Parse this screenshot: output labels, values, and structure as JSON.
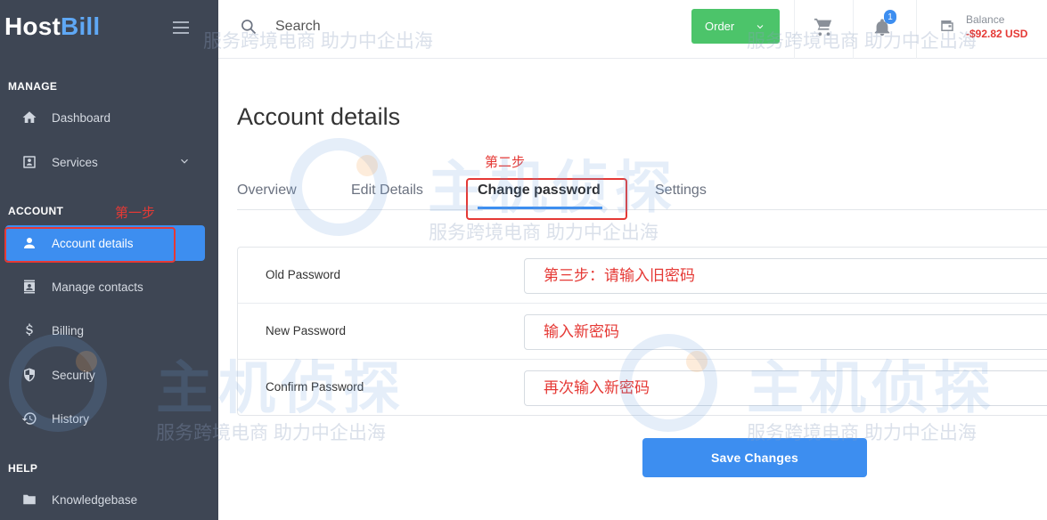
{
  "sidebar": {
    "brand_part1": "Host",
    "brand_part2": "Bill",
    "sections": {
      "manage": "MANAGE",
      "account": "ACCOUNT",
      "help": "HELP"
    },
    "items": [
      {
        "label": "Dashboard",
        "icon": "home-icon"
      },
      {
        "label": "Services",
        "icon": "services-icon"
      },
      {
        "label": "Account details",
        "icon": "user-icon"
      },
      {
        "label": "Manage contacts",
        "icon": "contacts-icon"
      },
      {
        "label": "Billing",
        "icon": "dollar-icon"
      },
      {
        "label": "Security",
        "icon": "shield-icon"
      },
      {
        "label": "History",
        "icon": "history-icon"
      },
      {
        "label": "Knowledgebase",
        "icon": "folder-icon"
      }
    ]
  },
  "topbar": {
    "search_placeholder": "Search",
    "order_label": "Order",
    "notification_count": "1",
    "balance_label": "Balance",
    "balance_value": "-$92.82 USD"
  },
  "main": {
    "title": "Account details",
    "tabs": [
      "Overview",
      "Edit Details",
      "Change password",
      "Settings"
    ],
    "form": {
      "old_password_label": "Old Password",
      "new_password_label": "New Password",
      "confirm_password_label": "Confirm Password",
      "old_password_value": "第三步：请输入旧密码",
      "new_password_value": "输入新密码",
      "confirm_password_value": "再次输入新密码"
    },
    "save_label": "Save Changes"
  },
  "annotations": {
    "step1": "第一步",
    "step2": "第二步"
  },
  "watermark": {
    "tagline": "服务跨境电商 助力中企出海",
    "brand": "主机侦探"
  },
  "colors": {
    "sidebar_bg": "#3e4654",
    "accent": "#3d8ef0",
    "order_green": "#4cc46a",
    "balance_red": "#e53935",
    "annotation_red": "#e53935"
  }
}
